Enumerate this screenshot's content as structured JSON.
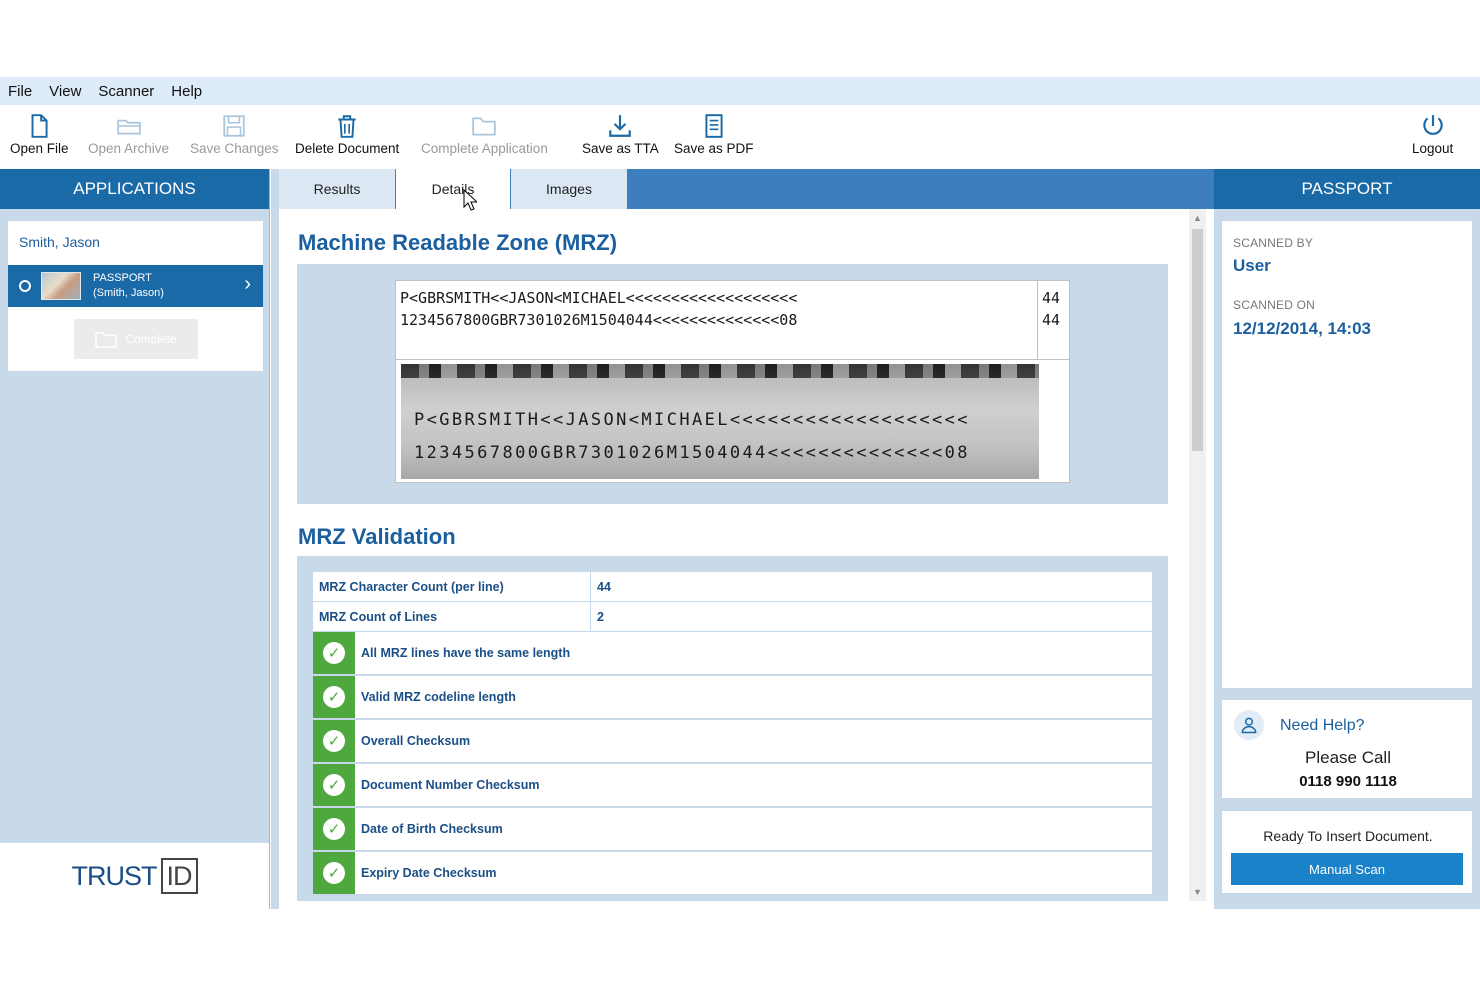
{
  "menu": [
    "File",
    "View",
    "Scanner",
    "Help"
  ],
  "toolbar": {
    "open_file": "Open File",
    "open_archive": "Open Archive",
    "save_changes": "Save Changes",
    "delete_document": "Delete Document",
    "complete_application": "Complete Application",
    "save_tta": "Save as TTA",
    "save_pdf": "Save as PDF",
    "logout": "Logout"
  },
  "left": {
    "header": "APPLICATIONS",
    "applicant": "Smith, Jason",
    "doc_type": "PASSPORT",
    "doc_owner": "(Smith, Jason)",
    "complete_label": "Complete",
    "logo_main": "TRUST",
    "logo_id": "ID"
  },
  "tabs": {
    "results": "Results",
    "details": "Details",
    "images": "Images"
  },
  "mrz": {
    "title": "Machine Readable Zone (MRZ)",
    "line1": "P<GBRSMITH<<JASON<MICHAEL<<<<<<<<<<<<<<<<<<<",
    "line2": "1234567800GBR7301026M1504044<<<<<<<<<<<<<<08",
    "count1": "44",
    "count2": "44"
  },
  "validation": {
    "title": "MRZ Validation",
    "char_count_label": "MRZ Character Count (per line)",
    "char_count_value": "44",
    "lines_label": "MRZ Count of Lines",
    "lines_value": "2",
    "checks": [
      "All MRZ lines have the same length",
      "Valid MRZ codeline length",
      "Overall Checksum",
      "Document Number Checksum",
      "Date of Birth Checksum",
      "Expiry Date Checksum"
    ]
  },
  "right": {
    "header": "PASSPORT",
    "scanned_by_label": "SCANNED BY",
    "scanned_by": "User",
    "scanned_on_label": "SCANNED ON",
    "scanned_on": "12/12/2014, 14:03",
    "help_title": "Need Help?",
    "help_call": "Please Call",
    "help_phone": "0118 990 1118",
    "ready": "Ready To Insert Document.",
    "manual_scan": "Manual Scan"
  },
  "colors": {
    "accent": "#1a6aa8",
    "tab_bar": "#3d7fbe",
    "panel": "#c8d9ea",
    "check": "#4fa83d"
  }
}
